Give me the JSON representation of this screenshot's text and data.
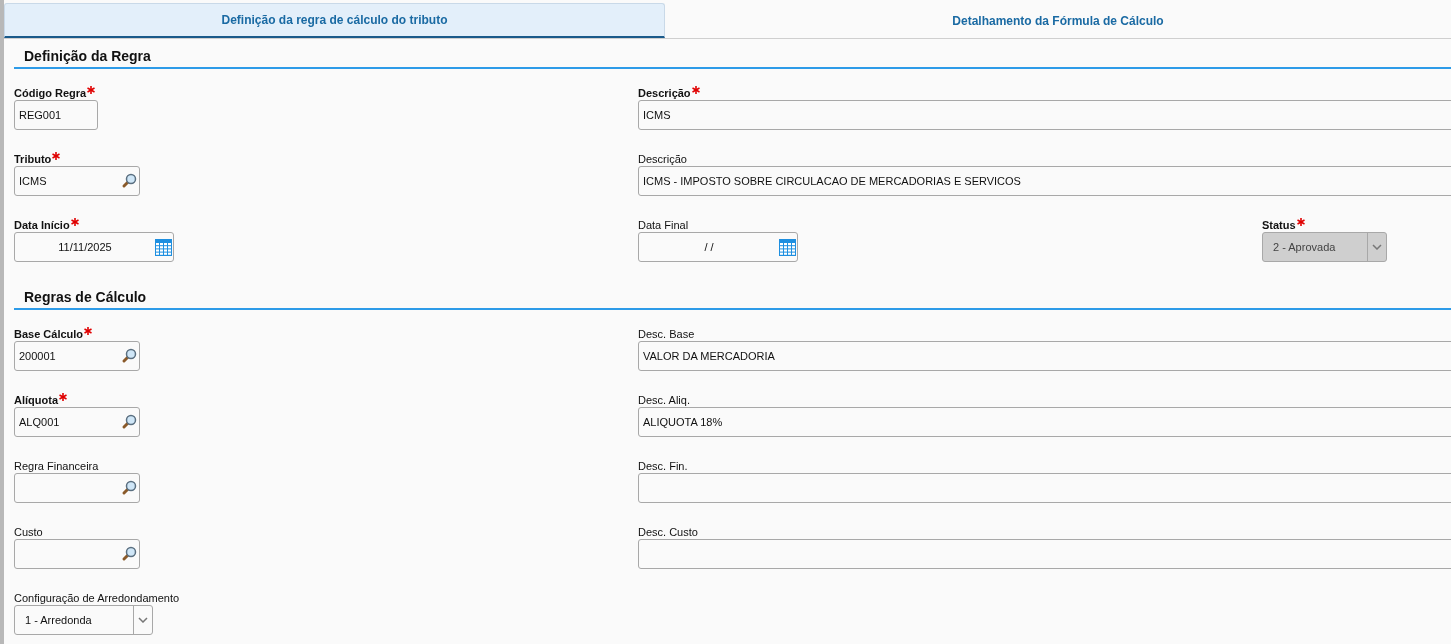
{
  "tabs": [
    {
      "label": "Definição da regra de cálculo do tributo",
      "selected": true
    },
    {
      "label": "Detalhamento da Fórmula de Cálculo",
      "selected": false
    }
  ],
  "sections": [
    {
      "title": "Definição da Regra",
      "rows": [
        [
          {
            "label": "Código Regra",
            "required": true,
            "kind": "text",
            "value": "REG001"
          },
          {
            "label": "Descrição",
            "required": true,
            "kind": "text",
            "value": "ICMS"
          }
        ],
        [
          {
            "label": "Tributo",
            "required": true,
            "kind": "lookup",
            "value": "ICMS"
          },
          {
            "label": "Descrição",
            "required": false,
            "kind": "text",
            "value": "ICMS - IMPOSTO SOBRE CIRCULACAO DE MERCADORIAS E SERVICOS"
          }
        ],
        [
          {
            "label": "Data Início",
            "required": true,
            "kind": "date",
            "value": "11/11/2025"
          },
          {
            "label": "Data Final",
            "required": false,
            "kind": "date",
            "value": "/ /"
          },
          {
            "label": "Status",
            "required": true,
            "kind": "select",
            "value": "2 - Aprovada",
            "disabled": true
          }
        ]
      ]
    },
    {
      "title": "Regras de Cálculo",
      "rows": [
        [
          {
            "label": "Base Cálculo",
            "required": true,
            "kind": "lookup",
            "value": "200001"
          },
          {
            "label": "Desc. Base",
            "required": false,
            "kind": "text",
            "value": "VALOR DA MERCADORIA"
          }
        ],
        [
          {
            "label": "Alíquota",
            "required": true,
            "kind": "lookup",
            "value": "ALQ001"
          },
          {
            "label": "Desc. Aliq.",
            "required": false,
            "kind": "text",
            "value": "ALIQUOTA 18%"
          }
        ],
        [
          {
            "label": "Regra Financeira",
            "required": false,
            "kind": "lookup"
          },
          {
            "label": "Desc. Fin.",
            "required": false,
            "kind": "text"
          }
        ],
        [
          {
            "label": "Custo",
            "required": false,
            "kind": "lookup"
          },
          {
            "label": "Desc. Custo",
            "required": false,
            "kind": "text"
          }
        ],
        [
          {
            "label": "Configuração de Arredondamento",
            "required": false,
            "kind": "select",
            "value": "1 - Arredonda",
            "disabled": false
          }
        ]
      ]
    }
  ]
}
